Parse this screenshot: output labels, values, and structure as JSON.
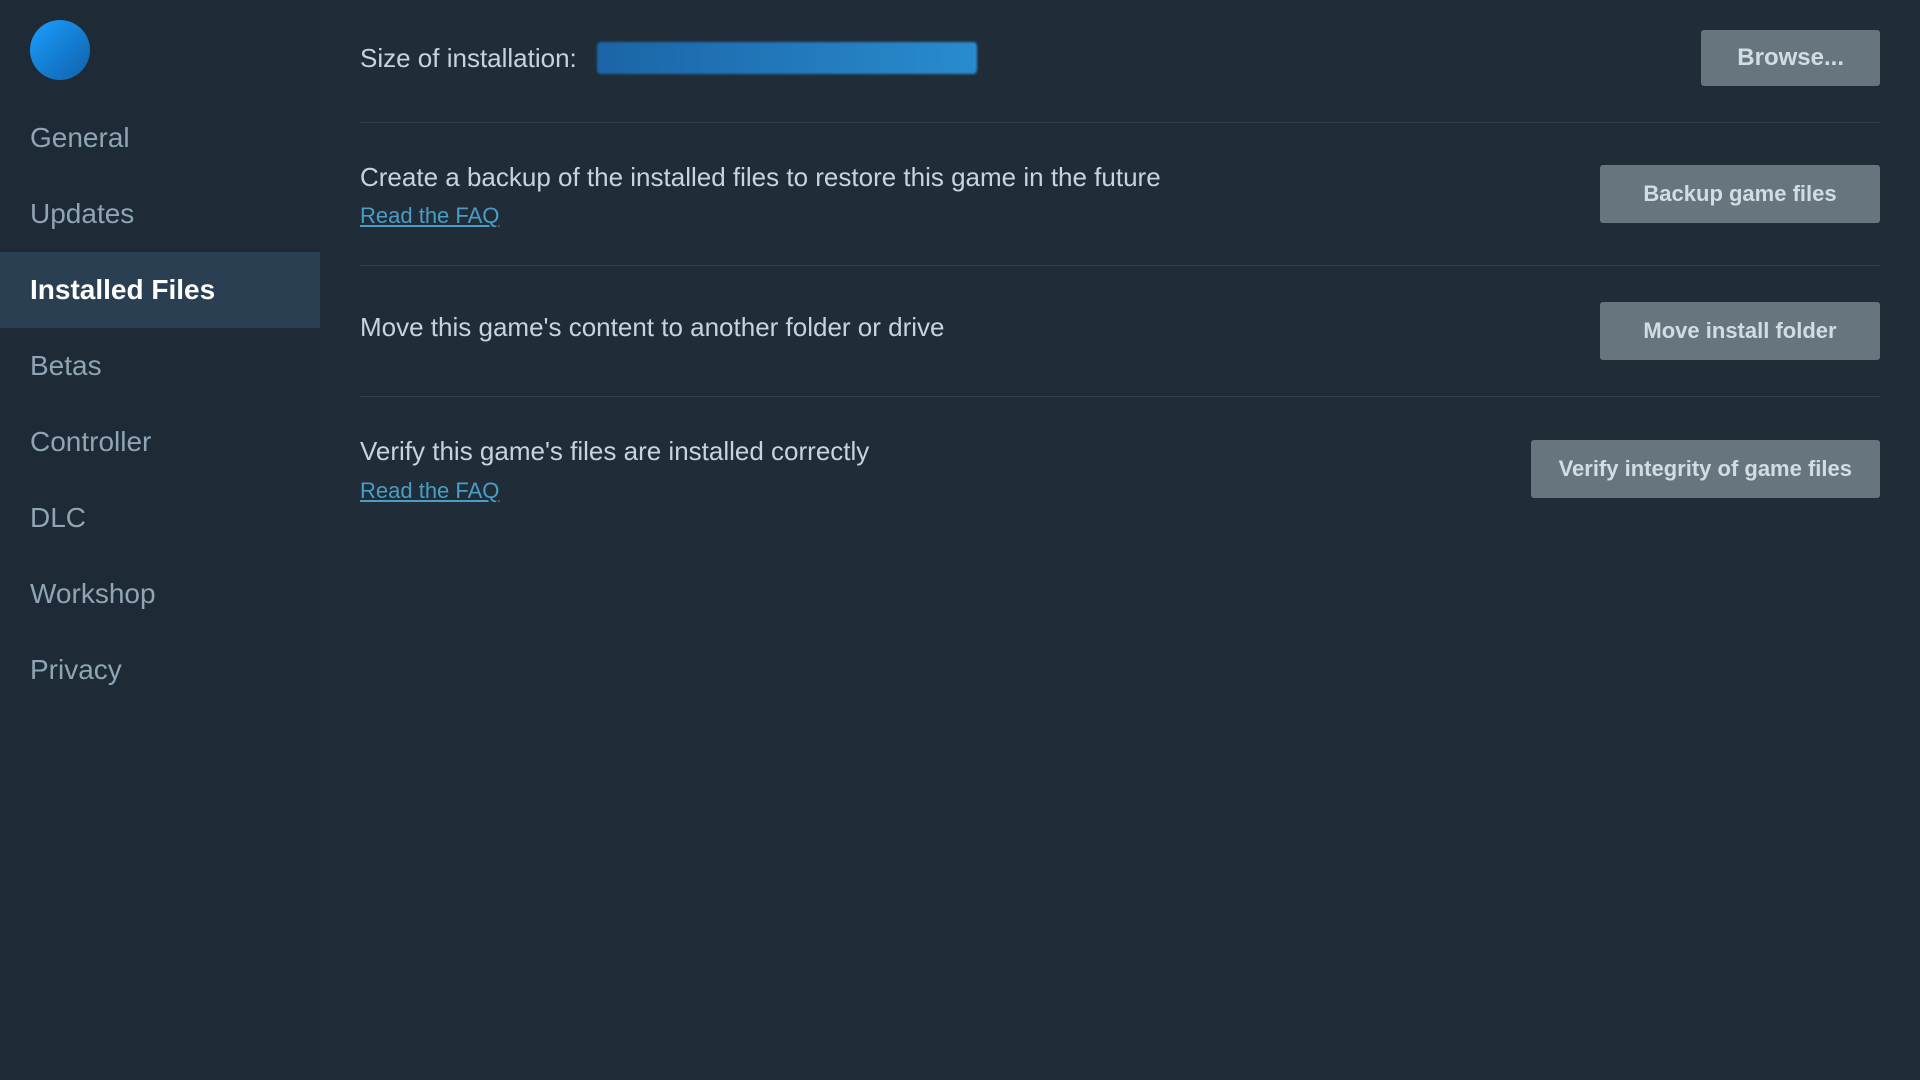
{
  "sidebar": {
    "items": [
      {
        "id": "general",
        "label": "General",
        "active": false
      },
      {
        "id": "updates",
        "label": "Updates",
        "active": false
      },
      {
        "id": "installed-files",
        "label": "Installed Files",
        "active": true
      },
      {
        "id": "betas",
        "label": "Betas",
        "active": false
      },
      {
        "id": "controller",
        "label": "Controller",
        "active": false
      },
      {
        "id": "dlc",
        "label": "DLC",
        "active": false
      },
      {
        "id": "workshop",
        "label": "Workshop",
        "active": false
      },
      {
        "id": "privacy",
        "label": "Privacy",
        "active": false
      }
    ]
  },
  "main": {
    "size_label": "Size of installation:",
    "browse_button_label": "Browse...",
    "sections": [
      {
        "id": "backup",
        "description": "Create a backup of the installed files to restore this game in the future",
        "link_text": "Read the FAQ",
        "button_label": "Backup game files"
      },
      {
        "id": "move",
        "description": "Move this game's content to another folder or drive",
        "link_text": null,
        "button_label": "Move install folder"
      },
      {
        "id": "verify",
        "description": "Verify this game's files are installed correctly",
        "link_text": "Read the FAQ",
        "button_label": "Verify integrity of game files"
      }
    ]
  }
}
